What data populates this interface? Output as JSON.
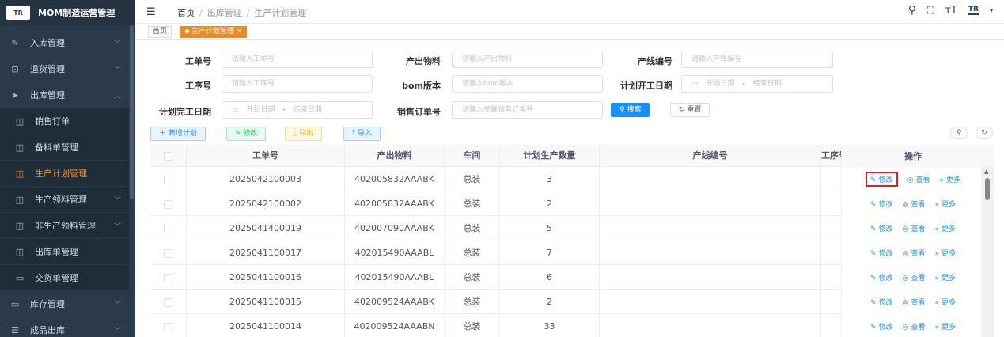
{
  "brand": {
    "logo_text": "TR",
    "title": "MOM制造运营管理"
  },
  "sidebar": {
    "items": [
      {
        "label": "入库管理",
        "icon": "edit-icon",
        "level": "top",
        "chevron": "﹀"
      },
      {
        "label": "退货管理",
        "icon": "return-icon",
        "level": "top",
        "chevron": "﹀"
      },
      {
        "label": "出库管理",
        "icon": "send-icon",
        "level": "top",
        "chevron": "︿"
      },
      {
        "label": "销售订单",
        "icon": "table-icon",
        "level": "sub"
      },
      {
        "label": "备料单管理",
        "icon": "table-icon",
        "level": "sub"
      },
      {
        "label": "生产计划管理",
        "icon": "table-icon",
        "level": "sub",
        "active": true
      },
      {
        "label": "生产领料管理",
        "icon": "table-icon",
        "level": "sub",
        "chevron": "﹀"
      },
      {
        "label": "非生产领料管理",
        "icon": "table-icon",
        "level": "sub",
        "chevron": "﹀"
      },
      {
        "label": "出库单管理",
        "icon": "table-icon",
        "level": "sub"
      },
      {
        "label": "交货单管理",
        "icon": "truck-icon",
        "level": "sub"
      },
      {
        "label": "库存管理",
        "icon": "monitor-icon",
        "level": "top",
        "chevron": "﹀"
      },
      {
        "label": "成品出库",
        "icon": "list-icon",
        "level": "top",
        "chevron": "﹀"
      }
    ]
  },
  "header": {
    "breadcrumb": [
      "首页",
      "出库管理",
      "生产计划管理"
    ],
    "logo_text": "TR"
  },
  "tags": {
    "home": "首页",
    "active": "生产计划管理",
    "close": "×"
  },
  "filters": {
    "work_order_no": {
      "label": "工单号",
      "placeholder": "请输入工单号"
    },
    "output_material": {
      "label": "产出物料",
      "placeholder": "请输入产出物料"
    },
    "line_no": {
      "label": "产线编号",
      "placeholder": "请输入产线编号"
    },
    "process_no": {
      "label": "工序号",
      "placeholder": "请输入工序号"
    },
    "bom_version": {
      "label": "bom版本",
      "placeholder": "请输入bom版本"
    },
    "plan_start_date": {
      "label": "计划开工日期",
      "start": "开始日期",
      "end": "结束日期",
      "dash": "-"
    },
    "plan_finish_date": {
      "label": "计划完工日期",
      "start": "开始日期",
      "end": "结束日期",
      "dash": "-"
    },
    "sales_order_no": {
      "label": "销售订单号",
      "placeholder": "请输入关联销售订单号"
    },
    "search_label": "搜索",
    "reset_label": "重置"
  },
  "toolbar": {
    "add_label": "新增计划",
    "edit_label": "修改",
    "export_label": "导出",
    "import_label": "导入"
  },
  "table": {
    "columns": [
      "工单号",
      "产出物料",
      "车间",
      "计划生产数量",
      "产线编号",
      "工序号",
      "操作"
    ],
    "row_actions": {
      "edit": "修改",
      "view": "查看",
      "more": "更多"
    },
    "rows": [
      {
        "work_order": "2025042100003",
        "material": "402005832AAABK",
        "workshop": "总装",
        "qty": "3",
        "line": "",
        "process": ""
      },
      {
        "work_order": "2025042100002",
        "material": "402005832AAABK",
        "workshop": "总装",
        "qty": "2",
        "line": "",
        "process": ""
      },
      {
        "work_order": "2025041400019",
        "material": "402007090AAABK",
        "workshop": "总装",
        "qty": "5",
        "line": "",
        "process": ""
      },
      {
        "work_order": "2025041100017",
        "material": "402015490AAABL",
        "workshop": "总装",
        "qty": "7",
        "line": "",
        "process": ""
      },
      {
        "work_order": "2025041100016",
        "material": "402015490AAABL",
        "workshop": "总装",
        "qty": "6",
        "line": "",
        "process": ""
      },
      {
        "work_order": "2025041100015",
        "material": "402009524AAABK",
        "workshop": "总装",
        "qty": "2",
        "line": "",
        "process": ""
      },
      {
        "work_order": "2025041100014",
        "material": "402009524AAABN",
        "workshop": "总装",
        "qty": "33",
        "line": "",
        "process": ""
      }
    ]
  }
}
